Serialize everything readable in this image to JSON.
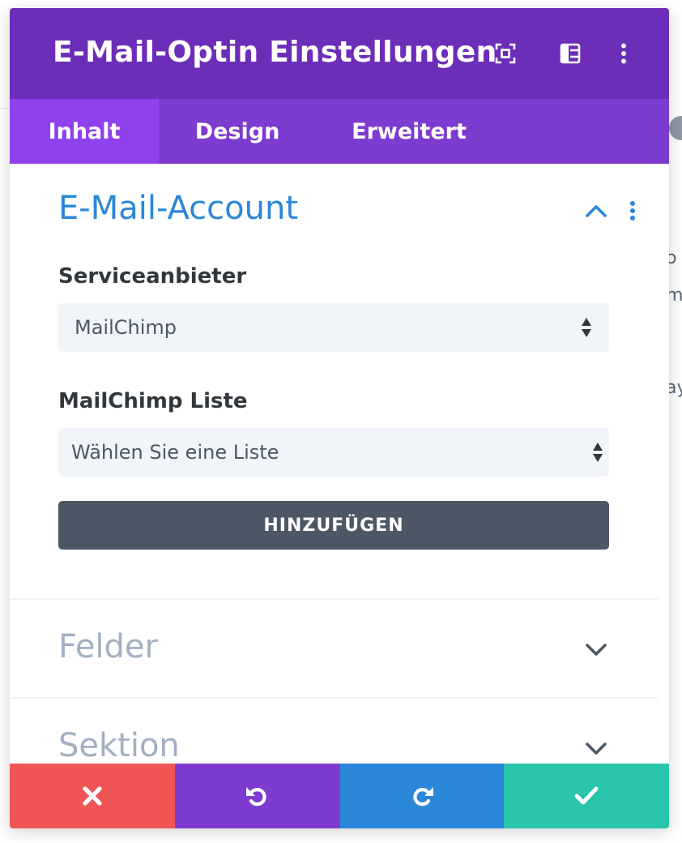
{
  "header": {
    "title": "E-Mail-Optin Einstellungen",
    "icons": [
      "expand-icon",
      "split-view-icon",
      "more-options-icon"
    ]
  },
  "tabs": [
    {
      "label": "Inhalt",
      "active": true
    },
    {
      "label": "Design",
      "active": false
    },
    {
      "label": "Erweitert",
      "active": false
    }
  ],
  "email_account": {
    "title": "E-Mail-Account",
    "expanded": true,
    "provider_label": "Serviceanbieter",
    "provider_value": "MailChimp",
    "list_label": "MailChimp Liste",
    "list_value": "Wählen Sie eine Liste",
    "add_button": "HINZUFÜGEN"
  },
  "sections": [
    {
      "title": "Felder",
      "expanded": false
    },
    {
      "title": "Sektion",
      "expanded": false
    }
  ],
  "footer": {
    "buttons": [
      {
        "name": "cancel",
        "icon": "close-icon",
        "color": "#ef5555"
      },
      {
        "name": "undo",
        "icon": "undo-icon",
        "color": "#7e3bd0"
      },
      {
        "name": "redo",
        "icon": "redo-icon",
        "color": "#2b87da"
      },
      {
        "name": "save",
        "icon": "check-icon",
        "color": "#29c4a9"
      }
    ]
  },
  "background_fragments": [
    "o",
    "m",
    "ay"
  ],
  "colors": {
    "header": "#6c2eb9",
    "tabs": "#7d3bcf",
    "active_tab": "#8f42ec",
    "accent_blue": "#2b87da",
    "muted_title": "#a3b0c2",
    "button_dark": "#4c5866"
  }
}
